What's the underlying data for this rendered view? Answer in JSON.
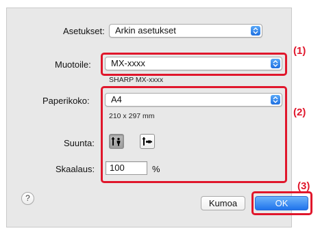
{
  "settings": {
    "label": "Asetukset:",
    "value": "Arkin asetukset"
  },
  "printer": {
    "label": "Muotoile:",
    "value": "MX-xxxx",
    "description": "SHARP MX-xxxx"
  },
  "paper": {
    "label": "Paperikoko:",
    "value": "A4",
    "dimensions": "210 x 297 mm"
  },
  "orientation": {
    "label": "Suunta:",
    "options": [
      "portrait",
      "landscape"
    ],
    "selected": "portrait"
  },
  "scale": {
    "label": "Skaalaus:",
    "value": "100",
    "unit": "%"
  },
  "buttons": {
    "help": "?",
    "cancel": "Kumoa",
    "ok": "OK"
  },
  "callouts": {
    "printer": "(1)",
    "paper": "(2)",
    "ok": "(3)"
  },
  "colors": {
    "highlight": "#e0162b",
    "accent": "#1f73ec",
    "panel": "#e8e8e8"
  }
}
